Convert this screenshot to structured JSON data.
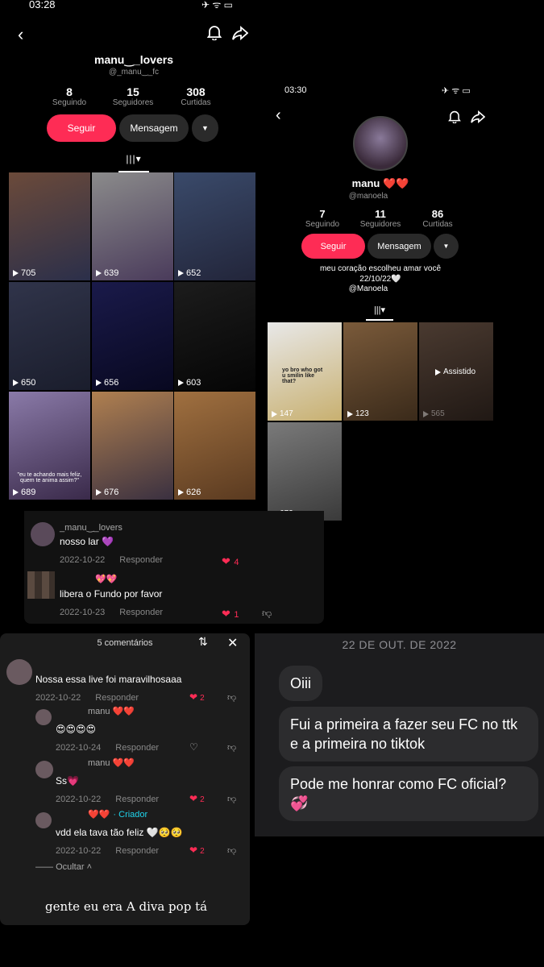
{
  "profile1": {
    "time": "03:28",
    "username": "manu‿_lovers",
    "handle": "@_manu‿_fc",
    "stats": [
      {
        "num": "8",
        "label": "Seguindo"
      },
      {
        "num": "15",
        "label": "Seguidores"
      },
      {
        "num": "308",
        "label": "Curtidas"
      }
    ],
    "follow_label": "Seguir",
    "message_label": "Mensagem",
    "videos": [
      {
        "count": "705",
        "colors": [
          "#6b4a3a",
          "#2b2f4a"
        ]
      },
      {
        "count": "639",
        "colors": [
          "#8b8b8b",
          "#4a3b5b"
        ]
      },
      {
        "count": "652",
        "colors": [
          "#3a4a6a",
          "#22253a"
        ]
      },
      {
        "count": "650",
        "colors": [
          "#30344a",
          "#1a1d2c"
        ]
      },
      {
        "count": "656",
        "colors": [
          "#1a1a4a",
          "#080820"
        ]
      },
      {
        "count": "603",
        "colors": [
          "#1c1c1c",
          "#050505"
        ]
      },
      {
        "count": "689",
        "colors": [
          "#8a7aa8",
          "#3a2a4a"
        ],
        "caption": "\"eu te achando mais feliz, quem te anima assim?\""
      },
      {
        "count": "676",
        "colors": [
          "#b08050",
          "#3a3040"
        ]
      },
      {
        "count": "626",
        "colors": [
          "#a07040",
          "#5a3a20"
        ]
      }
    ]
  },
  "profile2": {
    "time": "03:30",
    "username": "manu ❤️❤️",
    "handle": "@manoela",
    "stats": [
      {
        "num": "7",
        "label": "Seguindo"
      },
      {
        "num": "11",
        "label": "Seguidores"
      },
      {
        "num": "86",
        "label": "Curtidas"
      }
    ],
    "follow_label": "Seguir",
    "message_label": "Mensagem",
    "bio1": "meu coração escolheu amar você",
    "bio2": "22/10/22🤍",
    "bio3": "@Manoela",
    "videos": [
      {
        "count": "147",
        "colors": [
          "#e8e8e8",
          "#c8b070"
        ],
        "caption": "yo bro who got u smilin like that?"
      },
      {
        "count": "123",
        "colors": [
          "#7a5a3a",
          "#3a2a1a"
        ]
      },
      {
        "count": "565",
        "colors": [
          "#4a3a30",
          "#201814"
        ],
        "watched": "Assistido"
      },
      {
        "count": "672",
        "colors": [
          "#7a7a7a",
          "#3a3a3a"
        ]
      }
    ]
  },
  "comments_top": [
    {
      "name": "_manu‿_lovers",
      "text": "nosso lar 💜",
      "date": "2022-10-22",
      "reply": "Responder",
      "likes": "4"
    },
    {
      "name": "💖💖",
      "text": "libera o Fundo por favor",
      "date": "2022-10-23",
      "reply": "Responder",
      "likes": "1"
    }
  ],
  "comments_panel": {
    "header": "5 comentários",
    "items": [
      {
        "name": "",
        "text": "Nossa essa live foi maravilhosaaa",
        "date": "2022-10-22",
        "reply": "Responder",
        "likes": "2"
      },
      {
        "name": "manu ❤️❤️",
        "text": "😍😍😍😍",
        "date": "2022-10-24",
        "reply": "Responder",
        "likes": ""
      },
      {
        "name": "manu ❤️❤️",
        "text": "Ss💗",
        "date": "2022-10-22",
        "reply": "Responder",
        "likes": "2"
      },
      {
        "name": "❤️❤️",
        "creator": "· Criador",
        "text": "vdd ela tava tão feliz 🤍🥺🥺",
        "date": "2022-10-22",
        "reply": "Responder",
        "likes": "2"
      }
    ],
    "hide": "Ocultar",
    "caption": "gente eu era A diva pop tá"
  },
  "chat": {
    "date": "22 DE OUT. DE 2022",
    "messages": [
      "Oiii",
      "Fui a primeira a fazer seu FC no ttk e a primeira no tiktok",
      "Pode me honrar como FC oficial? 💞"
    ]
  },
  "colors": {
    "accent": "#fe2c55",
    "bg": "#000000",
    "panel": "#121212",
    "bubble": "#2c2c2e"
  }
}
